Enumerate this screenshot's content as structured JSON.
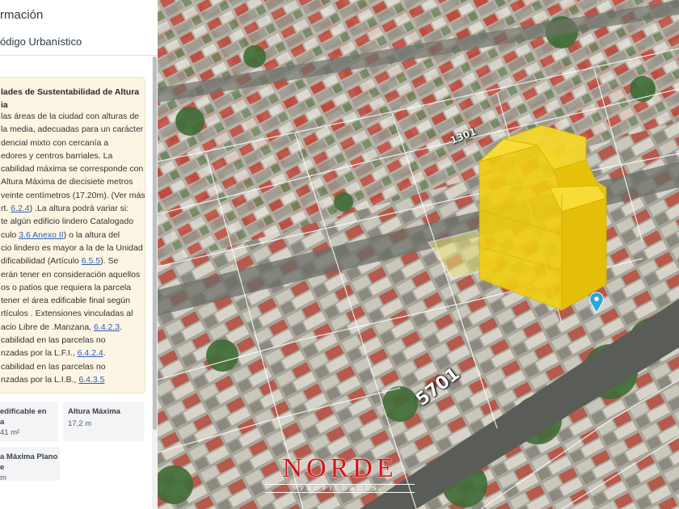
{
  "panel": {
    "title": "rmación",
    "subtitle": "ódigo Urbanístico",
    "info": {
      "title_lines": [
        "lades de Sustentabilidad de Altura",
        "ia"
      ],
      "body_lines": [
        [
          {
            "t": "las áreas de la ciudad con alturas de"
          }
        ],
        [
          {
            "t": "la media, adecuadas para un carácter"
          }
        ],
        [
          {
            "t": "dencial mixto con cercanía a"
          }
        ],
        [
          {
            "t": "edores y centros barriales. La"
          }
        ],
        [
          {
            "t": "cabilidad máxima se corresponde con"
          }
        ],
        [
          {
            "t": "Altura Máxima de diecisiete metros"
          }
        ],
        [
          {
            "t": "veinte centímetros (17.20m). (Ver más"
          }
        ],
        [
          {
            "t": "rt. "
          },
          {
            "t": "6.2.4",
            "link": true
          },
          {
            "t": ") .La altura podrá variar si:"
          }
        ],
        [
          {
            "t": "te algún edificio lindero Catalogado"
          }
        ],
        [
          {
            "t": "culo "
          },
          {
            "t": "3.6 Anexo II",
            "link": true
          },
          {
            "t": ") o la altura del"
          }
        ],
        [
          {
            "t": "cio lindero es mayor a la de la Unidad"
          }
        ],
        [
          {
            "t": "dificabilidad (Artículo "
          },
          {
            "t": "6.5.5",
            "link": true
          },
          {
            "t": "). Se"
          }
        ],
        [
          {
            "t": "erán tener en consideración aquellos"
          }
        ],
        [
          {
            "t": "os o patios que requiera la parcela"
          }
        ],
        [
          {
            "t": "tener el área edificable final según"
          }
        ],
        [
          {
            "t": "rtículos . Extensiones vinculadas al"
          }
        ],
        [
          {
            "t": "acio Libre de .Manzana, "
          },
          {
            "t": "6.4.2.3",
            "link": true
          },
          {
            "t": "."
          }
        ],
        [
          {
            "t": "cabilidad en las parcelas no"
          }
        ],
        [
          {
            "t": "nzadas por la L.F.I., "
          },
          {
            "t": "6.4.2.4",
            "link": true
          },
          {
            "t": "."
          }
        ],
        [
          {
            "t": "cabilidad en las parcelas no"
          }
        ],
        [
          {
            "t": "nzadas por la L.I.B., "
          },
          {
            "t": "6.4.3.5",
            "link": true
          }
        ]
      ]
    },
    "cards": {
      "fot": {
        "label_lines": [
          "edificable en",
          "a"
        ],
        "value": "41 m²"
      },
      "altura": {
        "label": "Altura Máxima",
        "value": "17,2 m"
      },
      "plano": {
        "label_lines": [
          "a Máxima Plano",
          "e"
        ],
        "value": "m"
      }
    }
  },
  "map": {
    "street_labels": [
      "5701",
      "1301"
    ],
    "building_color": "#f0cd0f",
    "marker_color": "#2aa7d8",
    "watermark": {
      "brand": "NORDE",
      "sub": "PROPIEDADES",
      "color": "#d4141b"
    }
  }
}
